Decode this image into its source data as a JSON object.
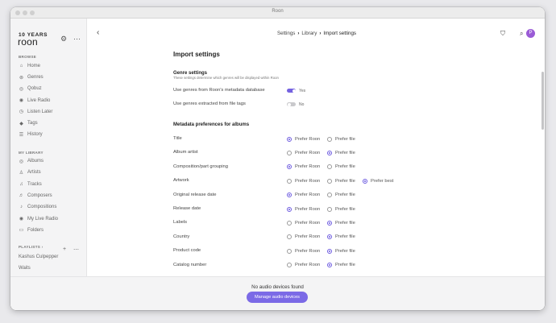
{
  "window": {
    "title": "Roon"
  },
  "sidebar": {
    "logo_years": "10 YEARS",
    "logo_name": "roon",
    "browse_header": "BROWSE",
    "browse_items": [
      {
        "label": "Home",
        "icon": "home-icon",
        "glyph": "⌂"
      },
      {
        "label": "Genres",
        "icon": "genres-icon",
        "glyph": "⊚"
      },
      {
        "label": "Qobuz",
        "icon": "qobuz-icon",
        "glyph": "◎"
      },
      {
        "label": "Live Radio",
        "icon": "radio-icon",
        "glyph": "◉"
      },
      {
        "label": "Listen Later",
        "icon": "listen-later-icon",
        "glyph": "◷"
      },
      {
        "label": "Tags",
        "icon": "tag-icon",
        "glyph": "◆"
      },
      {
        "label": "History",
        "icon": "history-icon",
        "glyph": "☰"
      }
    ],
    "library_header": "MY LIBRARY",
    "library_items": [
      {
        "label": "Albums",
        "icon": "albums-icon",
        "glyph": "◎"
      },
      {
        "label": "Artists",
        "icon": "artists-icon",
        "glyph": "♙"
      },
      {
        "label": "Tracks",
        "icon": "tracks-icon",
        "glyph": "♫"
      },
      {
        "label": "Composers",
        "icon": "composers-icon",
        "glyph": "♬"
      },
      {
        "label": "Compositions",
        "icon": "compositions-icon",
        "glyph": "♪"
      },
      {
        "label": "My Live Radio",
        "icon": "my-live-radio-icon",
        "glyph": "◉"
      },
      {
        "label": "Folders",
        "icon": "folder-icon",
        "glyph": "▭"
      }
    ],
    "playlists_header": "PLAYLISTS",
    "playlists": [
      {
        "label": "Kashus Culpepper"
      },
      {
        "label": "Waits"
      }
    ]
  },
  "topbar": {
    "breadcrumbs": [
      "Settings",
      "Library",
      "Import settings"
    ]
  },
  "main": {
    "page_title": "Import settings",
    "genre_section": {
      "title": "Genre settings",
      "subtitle": "These settings determine which genres will be displayed within Roon",
      "rows": [
        {
          "label": "Use genres from Roon's metadata database",
          "on": true,
          "state": "Yes"
        },
        {
          "label": "Use genres extracted from file tags",
          "on": false,
          "state": "No"
        }
      ]
    },
    "metadata_section": {
      "title": "Metadata preferences for albums",
      "options": [
        "Prefer Roon",
        "Prefer file",
        "Prefer best"
      ],
      "rows": [
        {
          "label": "Title",
          "selected": "Prefer Roon",
          "has_best": false
        },
        {
          "label": "Album artist",
          "selected": "Prefer file",
          "has_best": false
        },
        {
          "label": "Composition/part grouping",
          "selected": "Prefer Roon",
          "has_best": false
        },
        {
          "label": "Artwork",
          "selected": "Prefer best",
          "has_best": true
        },
        {
          "label": "Original release date",
          "selected": "Prefer Roon",
          "has_best": false
        },
        {
          "label": "Release date",
          "selected": "Prefer Roon",
          "has_best": false
        },
        {
          "label": "Labels",
          "selected": "Prefer file",
          "has_best": false
        },
        {
          "label": "Country",
          "selected": "Prefer file",
          "has_best": false
        },
        {
          "label": "Product code",
          "selected": "Prefer file",
          "has_best": false
        },
        {
          "label": "Catalog number",
          "selected": "Prefer file",
          "has_best": false
        }
      ]
    }
  },
  "bottom": {
    "status": "No audio devices found",
    "button": "Manage audio devices"
  },
  "avatar_letter": "P",
  "colors": {
    "accent": "#7562e0",
    "avatar": "#9a5bd6"
  }
}
